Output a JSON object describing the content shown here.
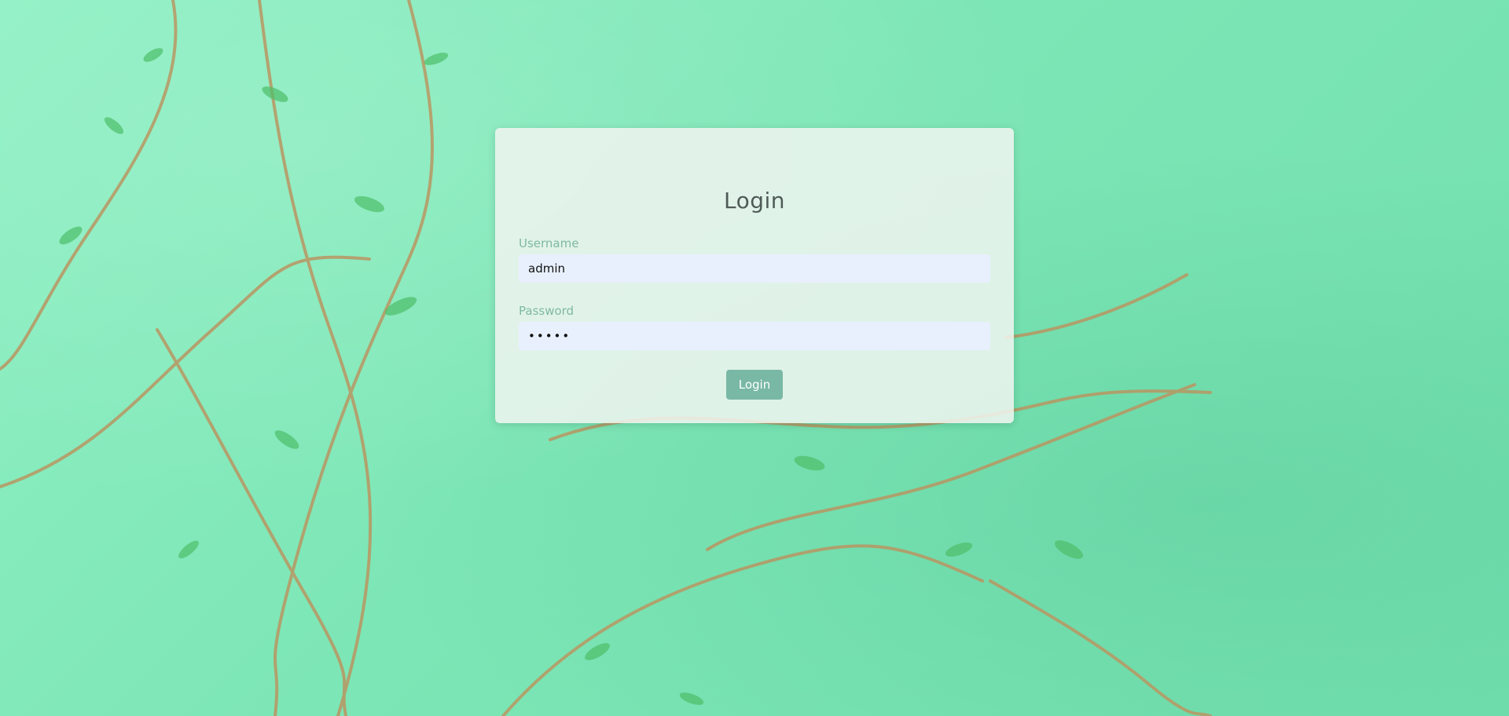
{
  "login": {
    "title": "Login",
    "username_label": "Username",
    "username_value": "admin",
    "password_label": "Password",
    "password_value": "•••••",
    "submit_label": "Login"
  },
  "colors": {
    "background": "#7fe7b9",
    "card": "#f0f5f0",
    "input_bg": "#e8f0fe",
    "label": "#7fb9a0",
    "button": "#79b8a5",
    "title": "#4f5b57"
  },
  "background_image": {
    "subject": "green wall with climbing vines"
  }
}
